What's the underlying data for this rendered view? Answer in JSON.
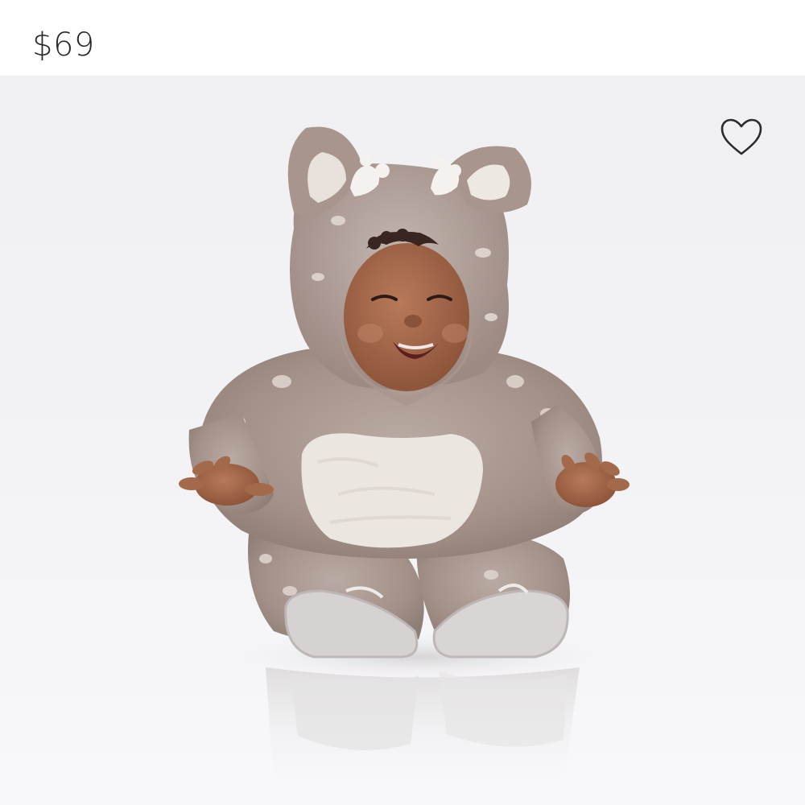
{
  "product": {
    "price": "$69",
    "image_subject": "baby-in-fawn-costume-photo"
  },
  "actions": {
    "favorite_icon": "heart-outline-icon"
  },
  "colors": {
    "price_text": "#2a2a2a",
    "image_background": "#f0f0f2",
    "heart_stroke": "#2b2b2b"
  }
}
